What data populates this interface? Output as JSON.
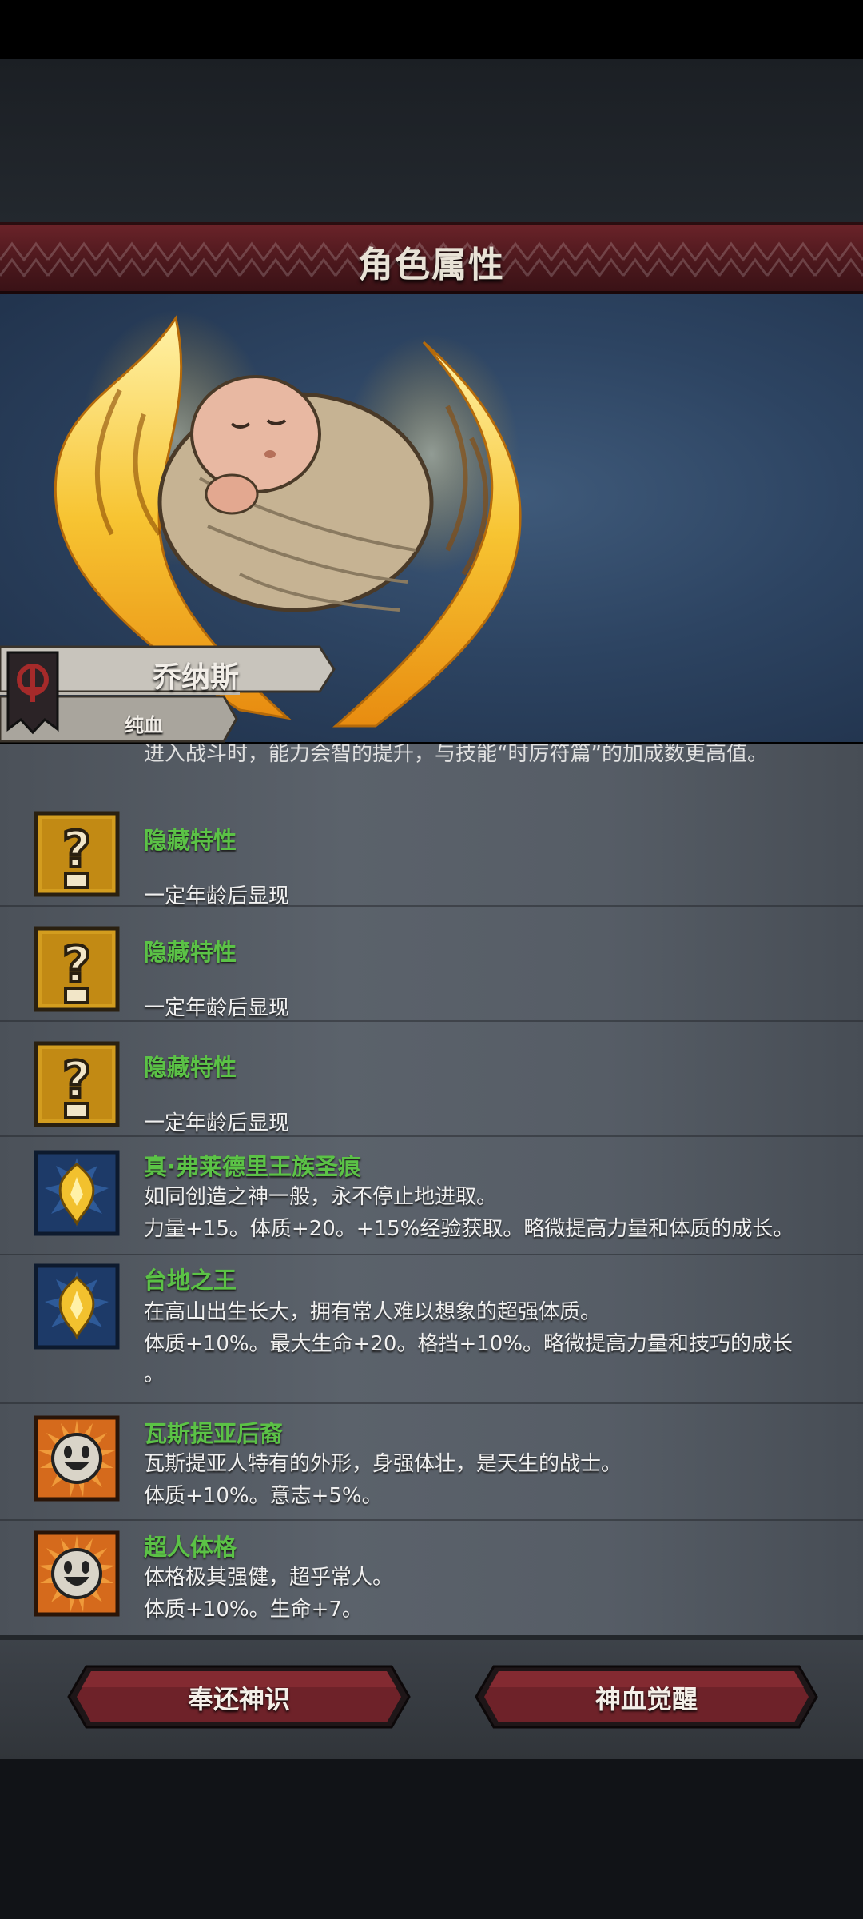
{
  "header": {
    "title": "角色属性"
  },
  "character": {
    "name": "乔纳斯",
    "lineage": "纯血"
  },
  "list": {
    "cut_text": "进入战斗时，能力会智的提升，与技能“时厉符篇”的加成数更高值。",
    "items": [
      {
        "icon": "question-mark-icon",
        "name": "隐藏特性",
        "lines": [
          "",
          "一定年龄后显现"
        ]
      },
      {
        "icon": "question-mark-icon",
        "name": "隐藏特性",
        "lines": [
          "",
          "一定年龄后显现"
        ]
      },
      {
        "icon": "question-mark-icon",
        "name": "隐藏特性",
        "lines": [
          "",
          "一定年龄后显现"
        ]
      },
      {
        "icon": "golden-crest-icon",
        "name": "真·弗莱德里王族圣痕",
        "lines": [
          "如同创造之神一般，永不停止地进取。",
          "力量+15。体质+20。+15%经验获取。略微提高力量和体质的成长。"
        ]
      },
      {
        "icon": "golden-crest-icon",
        "name": "台地之王",
        "lines": [
          "在高山出生长大，拥有常人难以想象的超强体质。",
          "体质+10%。最大生命+20。格挡+10%。略微提高力量和技巧的成长",
          "。"
        ]
      },
      {
        "icon": "smiley-face-icon",
        "name": "瓦斯提亚后裔",
        "lines": [
          "瓦斯提亚人特有的外形，身强体壮，是天生的战士。",
          "体质+10%。意志+5%。"
        ]
      },
      {
        "icon": "smiley-face-icon",
        "name": "超人体格",
        "lines": [
          "体格极其强健，超乎常人。",
          "体质+10%。生命+7。"
        ]
      }
    ]
  },
  "footer": {
    "left_button": "奉还神识",
    "right_button": "神血觉醒"
  },
  "colors": {
    "trait_name": "#5bc246",
    "header_red": "#5a1c21",
    "icon_gold": "#d39d1f"
  }
}
